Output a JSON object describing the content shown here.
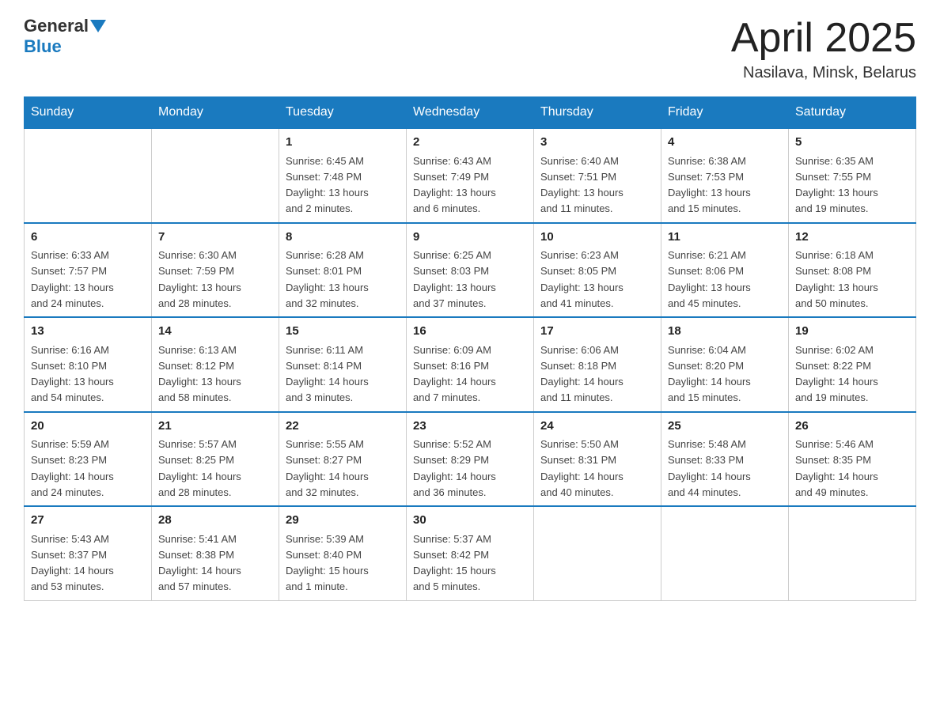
{
  "header": {
    "logo_general": "General",
    "logo_blue": "Blue",
    "month_title": "April 2025",
    "location": "Nasilava, Minsk, Belarus"
  },
  "days_of_week": [
    "Sunday",
    "Monday",
    "Tuesday",
    "Wednesday",
    "Thursday",
    "Friday",
    "Saturday"
  ],
  "weeks": [
    [
      {
        "day": "",
        "info": ""
      },
      {
        "day": "",
        "info": ""
      },
      {
        "day": "1",
        "info": "Sunrise: 6:45 AM\nSunset: 7:48 PM\nDaylight: 13 hours\nand 2 minutes."
      },
      {
        "day": "2",
        "info": "Sunrise: 6:43 AM\nSunset: 7:49 PM\nDaylight: 13 hours\nand 6 minutes."
      },
      {
        "day": "3",
        "info": "Sunrise: 6:40 AM\nSunset: 7:51 PM\nDaylight: 13 hours\nand 11 minutes."
      },
      {
        "day": "4",
        "info": "Sunrise: 6:38 AM\nSunset: 7:53 PM\nDaylight: 13 hours\nand 15 minutes."
      },
      {
        "day": "5",
        "info": "Sunrise: 6:35 AM\nSunset: 7:55 PM\nDaylight: 13 hours\nand 19 minutes."
      }
    ],
    [
      {
        "day": "6",
        "info": "Sunrise: 6:33 AM\nSunset: 7:57 PM\nDaylight: 13 hours\nand 24 minutes."
      },
      {
        "day": "7",
        "info": "Sunrise: 6:30 AM\nSunset: 7:59 PM\nDaylight: 13 hours\nand 28 minutes."
      },
      {
        "day": "8",
        "info": "Sunrise: 6:28 AM\nSunset: 8:01 PM\nDaylight: 13 hours\nand 32 minutes."
      },
      {
        "day": "9",
        "info": "Sunrise: 6:25 AM\nSunset: 8:03 PM\nDaylight: 13 hours\nand 37 minutes."
      },
      {
        "day": "10",
        "info": "Sunrise: 6:23 AM\nSunset: 8:05 PM\nDaylight: 13 hours\nand 41 minutes."
      },
      {
        "day": "11",
        "info": "Sunrise: 6:21 AM\nSunset: 8:06 PM\nDaylight: 13 hours\nand 45 minutes."
      },
      {
        "day": "12",
        "info": "Sunrise: 6:18 AM\nSunset: 8:08 PM\nDaylight: 13 hours\nand 50 minutes."
      }
    ],
    [
      {
        "day": "13",
        "info": "Sunrise: 6:16 AM\nSunset: 8:10 PM\nDaylight: 13 hours\nand 54 minutes."
      },
      {
        "day": "14",
        "info": "Sunrise: 6:13 AM\nSunset: 8:12 PM\nDaylight: 13 hours\nand 58 minutes."
      },
      {
        "day": "15",
        "info": "Sunrise: 6:11 AM\nSunset: 8:14 PM\nDaylight: 14 hours\nand 3 minutes."
      },
      {
        "day": "16",
        "info": "Sunrise: 6:09 AM\nSunset: 8:16 PM\nDaylight: 14 hours\nand 7 minutes."
      },
      {
        "day": "17",
        "info": "Sunrise: 6:06 AM\nSunset: 8:18 PM\nDaylight: 14 hours\nand 11 minutes."
      },
      {
        "day": "18",
        "info": "Sunrise: 6:04 AM\nSunset: 8:20 PM\nDaylight: 14 hours\nand 15 minutes."
      },
      {
        "day": "19",
        "info": "Sunrise: 6:02 AM\nSunset: 8:22 PM\nDaylight: 14 hours\nand 19 minutes."
      }
    ],
    [
      {
        "day": "20",
        "info": "Sunrise: 5:59 AM\nSunset: 8:23 PM\nDaylight: 14 hours\nand 24 minutes."
      },
      {
        "day": "21",
        "info": "Sunrise: 5:57 AM\nSunset: 8:25 PM\nDaylight: 14 hours\nand 28 minutes."
      },
      {
        "day": "22",
        "info": "Sunrise: 5:55 AM\nSunset: 8:27 PM\nDaylight: 14 hours\nand 32 minutes."
      },
      {
        "day": "23",
        "info": "Sunrise: 5:52 AM\nSunset: 8:29 PM\nDaylight: 14 hours\nand 36 minutes."
      },
      {
        "day": "24",
        "info": "Sunrise: 5:50 AM\nSunset: 8:31 PM\nDaylight: 14 hours\nand 40 minutes."
      },
      {
        "day": "25",
        "info": "Sunrise: 5:48 AM\nSunset: 8:33 PM\nDaylight: 14 hours\nand 44 minutes."
      },
      {
        "day": "26",
        "info": "Sunrise: 5:46 AM\nSunset: 8:35 PM\nDaylight: 14 hours\nand 49 minutes."
      }
    ],
    [
      {
        "day": "27",
        "info": "Sunrise: 5:43 AM\nSunset: 8:37 PM\nDaylight: 14 hours\nand 53 minutes."
      },
      {
        "day": "28",
        "info": "Sunrise: 5:41 AM\nSunset: 8:38 PM\nDaylight: 14 hours\nand 57 minutes."
      },
      {
        "day": "29",
        "info": "Sunrise: 5:39 AM\nSunset: 8:40 PM\nDaylight: 15 hours\nand 1 minute."
      },
      {
        "day": "30",
        "info": "Sunrise: 5:37 AM\nSunset: 8:42 PM\nDaylight: 15 hours\nand 5 minutes."
      },
      {
        "day": "",
        "info": ""
      },
      {
        "day": "",
        "info": ""
      },
      {
        "day": "",
        "info": ""
      }
    ]
  ]
}
